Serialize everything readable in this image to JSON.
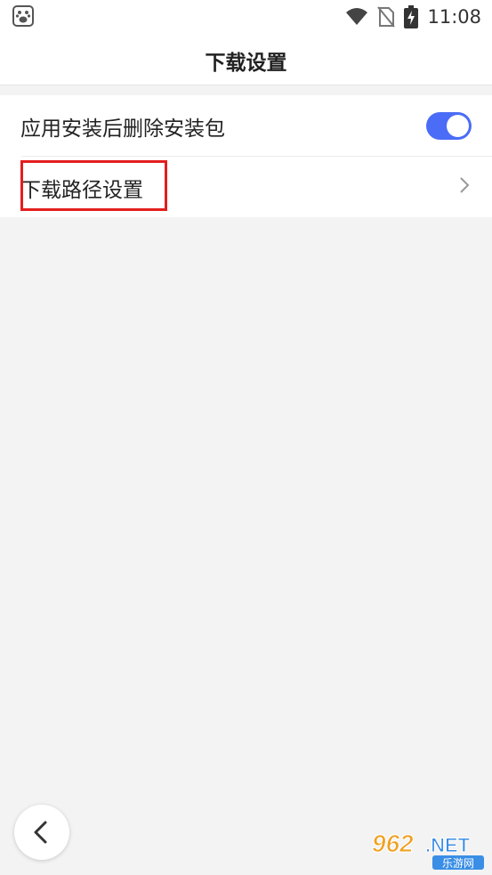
{
  "status_bar": {
    "time": "11:08",
    "icons": [
      "baidu-app-icon",
      "wifi-icon",
      "no-sim-icon",
      "battery-charging-icon"
    ]
  },
  "header": {
    "title": "下载设置"
  },
  "settings": {
    "items": [
      {
        "label": "应用安装后删除安装包",
        "control": "toggle",
        "enabled": true
      },
      {
        "label": "下载路径设置",
        "control": "chevron-right-icon"
      }
    ]
  },
  "colors": {
    "toggle_on": "#4a6cf7",
    "highlight": "#e41e1e",
    "background": "#f3f3f3"
  },
  "watermark": {
    "logo_text": "962.NET",
    "sub_text": "乐游网"
  }
}
